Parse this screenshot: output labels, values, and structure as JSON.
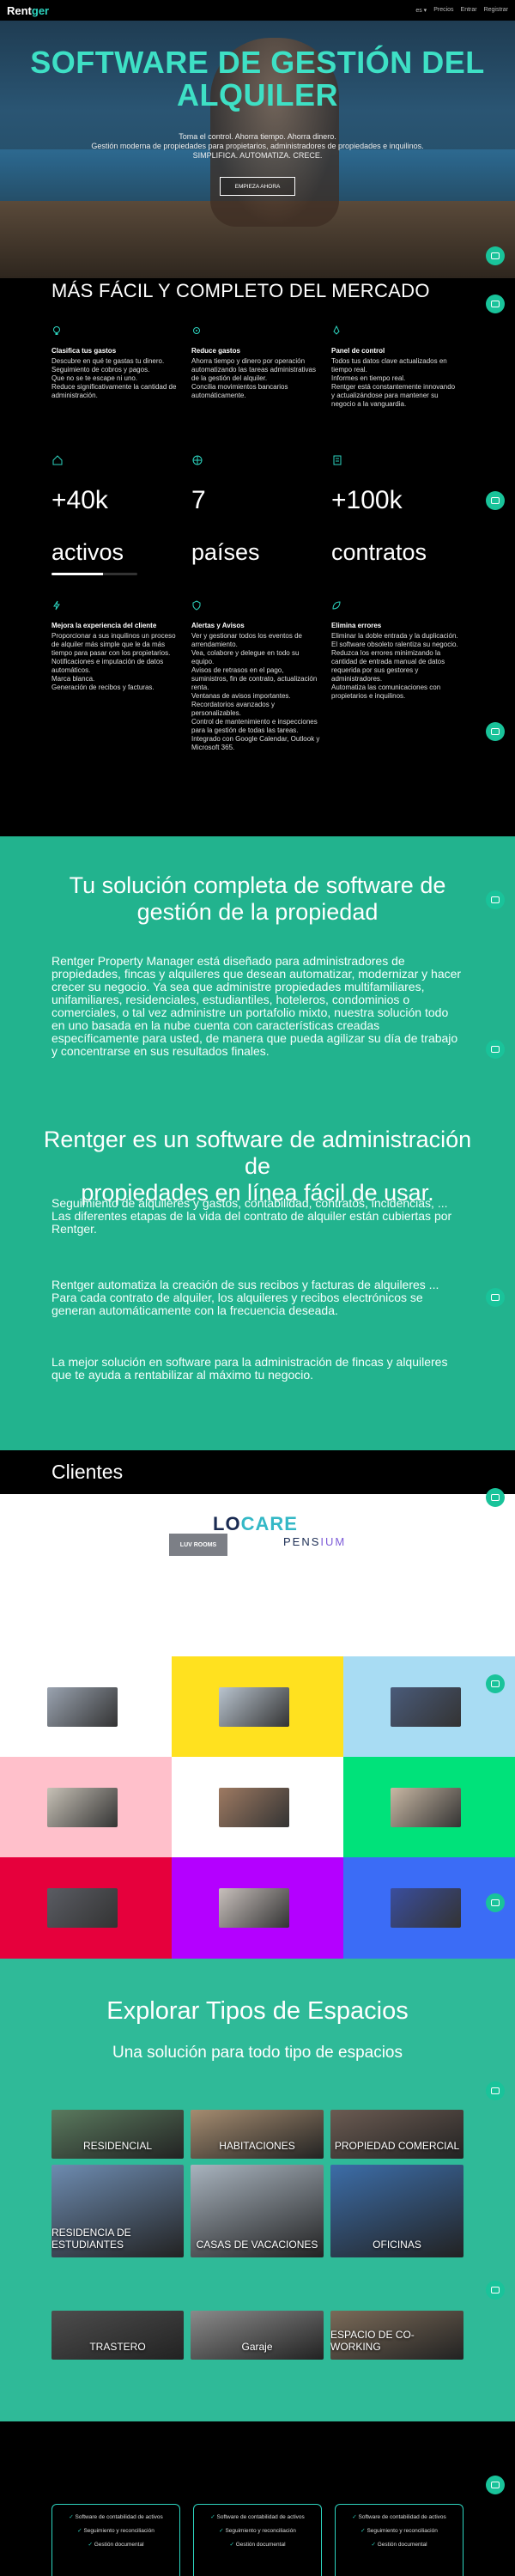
{
  "nav": {
    "logo_text": "Rent",
    "logo_accent": "ger",
    "links": [
      "es ▾",
      "Precios",
      "Entrar",
      "Registrar"
    ]
  },
  "hero": {
    "title_line1": "SOFTWARE DE GESTIÓN DEL",
    "title_line2": "ALQUILER",
    "sub1": "Toma el control. Ahorra tiempo. Ahorra dinero.",
    "sub2": "Gestión moderna de propiedades para propietarios, administradores de propiedades e inquilinos.",
    "sub3": "SIMPLIFICA. AUTOMATIZA. CRECE.",
    "cta": "EMPIEZA AHORA"
  },
  "features": {
    "heading": "MÁS FÁCIL Y COMPLETO DEL MERCADO",
    "row1": [
      {
        "icon": "bulb-icon",
        "title": "Clasifica tus gastos",
        "lines": [
          "Descubre en qué te gastas tu dinero.",
          "Seguimiento de cobros y pagos.",
          "Que no se te escape ni uno.",
          "Reduce significativamente la cantidad de administración."
        ]
      },
      {
        "icon": "gear-icon",
        "title": "Reduce gastos",
        "lines": [
          "Ahorra tiempo y dinero por operación automatizando las tareas administrativas de la gestión del alquiler.",
          "Concilia movimientos bancarios automáticamente."
        ]
      },
      {
        "icon": "rocket-icon",
        "title": "Panel de control",
        "lines": [
          "Todos tus datos clave actualizados en tiempo real.",
          "Informes en tiempo real.",
          "Rentger está constantemente innovando y actualizándose para mantener su negocio a la vanguardia."
        ]
      }
    ],
    "stats": [
      {
        "icon": "home-icon",
        "num": "+40k",
        "label": "activos"
      },
      {
        "icon": "globe-icon",
        "num": "7",
        "label": "países"
      },
      {
        "icon": "document-icon",
        "num": "+100k",
        "label": "contratos"
      }
    ],
    "row2": [
      {
        "icon": "lightning-icon",
        "title": "Mejora la experiencia del cliente",
        "lines": [
          "Proporcionar a sus inquilinos un proceso de alquiler más simple que le da más tiempo para pasar con los propietarios.",
          "Notificaciones e imputación de datos automáticos.",
          "Marca blanca.",
          "Generación de recibos y facturas."
        ]
      },
      {
        "icon": "shield-icon",
        "title": "Alertas y Avisos",
        "lines": [
          "Ver y gestionar todos los eventos de arrendamiento.",
          "Vea, colabore y delegue en todo su equipo.",
          "Avisos de retrasos en el pago, suministros, fin de contrato, actualización renta.",
          "Ventanas de avisos importantes.",
          "Recordatorios avanzados y personalizables.",
          "Control de mantenimiento e inspecciones para la gestión de todas las tareas.",
          "Integrado con Google Calendar, Outlook y Microsoft 365."
        ]
      },
      {
        "icon": "leaf-icon",
        "title": "Elimina errores",
        "lines": [
          "Eliminar la doble entrada y la duplicación.",
          "El software obsoleto ralentiza su negocio.",
          "Reduzca los errores minimizando la cantidad de entrada manual de datos requerida por sus gestores y administradores.",
          "Automatiza las comunicaciones con propietarios e inquilinos."
        ]
      }
    ]
  },
  "solution": {
    "h1_line1": "Tu solución completa de software de",
    "h1_line2": "gestión de la propiedad",
    "p1": "Rentger Property Manager está diseñado para administradores de propiedades, fincas y alquileres que desean automatizar, modernizar y hacer crecer su negocio. Ya sea que administre propiedades multifamiliares, unifamiliares, residenciales, estudiantiles, hoteleros, condominios o comerciales, o tal vez administre un portafolio mixto, nuestra solución todo en uno basada en la nube cuenta con características creadas específicamente para usted, de manera que pueda agilizar su día de trabajo y concentrarse en sus resultados finales.",
    "h2_line1": "Rentger es un software de administración de",
    "h2_line2": "propiedades en línea fácil de usar.",
    "p2": "Seguimiento de alquileres y gastos, contabilidad, contratos, incidencias, ... Las diferentes etapas de la vida del contrato de alquiler están cubiertas por Rentger.",
    "p3": "Rentger automatiza la creación de sus recibos y facturas de alquileres ... Para cada contrato de alquiler, los alquileres y recibos electrónicos se generan automáticamente con la frecuencia deseada.",
    "p4": "La mejor solución en software para la administración de fincas y alquileres que te ayuda a rentabilizar al máximo tu negocio."
  },
  "clients": {
    "heading": "Clientes",
    "logos": [
      {
        "name": "LUV ROOMS",
        "a": "LUV",
        "b": "ROOMS"
      },
      {
        "name": "LOCARE",
        "a": "LO",
        "b": "CARE"
      },
      {
        "name": "PENSIUM",
        "a": "PENS",
        "b": "IUM"
      }
    ]
  },
  "grid": {
    "colors": [
      "#ffffff",
      "#ffe11f",
      "#a8dcf3",
      "#ffc0cb",
      "#ffffff",
      "#00e27a",
      "#e6003c",
      "#b400ff",
      "#3b6cf6"
    ],
    "photo_colors": [
      "#9aa3b0",
      "#b9c4cf",
      "#4a5b7a",
      "#c7c1b6",
      "#9e7a62",
      "#c9b8a4",
      "#5a5c63",
      "#c8c0bc",
      "#3a4e9e"
    ]
  },
  "spaces": {
    "heading": "Explorar Tipos de Espacios",
    "subheading": "Una solución para todo tipo de espacios",
    "tiles": [
      {
        "label": "RESIDENCIAL",
        "color": "#5a7a5e"
      },
      {
        "label": "HABITACIONES",
        "color": "#a58c70"
      },
      {
        "label": "PROPIEDAD COMERCIAL",
        "color": "#6b5b52"
      },
      {
        "label": "RESIDENCIA DE ESTUDIANTES",
        "color": "#6d8bb0"
      },
      {
        "label": "CASAS DE VACACIONES",
        "color": "#a8b3be"
      },
      {
        "label": "OFICINAS",
        "color": "#3c6da8"
      },
      {
        "label": "TRASTERO",
        "color": "#4d4d4d"
      },
      {
        "label": "Garaje",
        "color": "#8a8a8a"
      },
      {
        "label": "ESPACIO DE CO-WORKING",
        "color": "#7a6a58"
      }
    ]
  },
  "footer": {
    "items": [
      "Software de contabilidad de activos",
      "Seguimiento y reconciliación",
      "Gestión documental"
    ]
  }
}
